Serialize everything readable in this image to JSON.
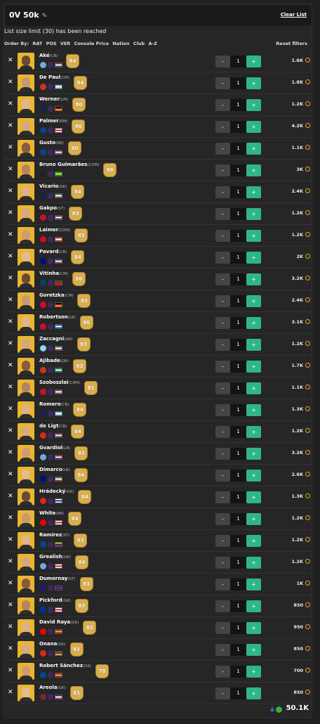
{
  "header": {
    "title": "0V 50k",
    "clear_label": "Clear List"
  },
  "limit_message": "List size limit (30) has been reached",
  "order_by": {
    "label": "Order By:",
    "options": [
      "RAT",
      "POS",
      "VER",
      "Console Price",
      "Nation",
      "Club",
      "A-Z"
    ]
  },
  "reset_label": "Reset filters",
  "players": [
    {
      "name": "Aké",
      "pos": "(CB)",
      "rating": "84",
      "qty": "1",
      "price": "1.6K",
      "club_color": "#6cabdd",
      "flag": [
        "#ae1c28",
        "#ffffff",
        "#21468b"
      ]
    },
    {
      "name": "De Paul",
      "pos": "(CM)",
      "rating": "84",
      "qty": "1",
      "price": "1.8K",
      "club_color": "#cb3524",
      "flag": [
        "#74acdf",
        "#ffffff",
        "#74acdf"
      ]
    },
    {
      "name": "Werner",
      "pos": "(LM)",
      "rating": "80",
      "qty": "1",
      "price": "1.2K",
      "club_color": "#132257",
      "flag": [
        "#000000",
        "#dd0000",
        "#ffce00"
      ]
    },
    {
      "name": "Palmer",
      "pos": "(RM)",
      "rating": "86",
      "qty": "1",
      "price": "4.2K",
      "club_color": "#034694",
      "flag": [
        "#ffffff",
        "#cf142b",
        "#ffffff"
      ]
    },
    {
      "name": "Gusto",
      "pos": "(RB)",
      "rating": "80",
      "qty": "1",
      "price": "1.1K",
      "club_color": "#034694",
      "flag": [
        "#002395",
        "#ffffff",
        "#ed2939"
      ]
    },
    {
      "name": "Bruno Guimarães",
      "pos": "(CDM)",
      "rating": "86",
      "qty": "1",
      "price": "3K",
      "club_color": "#241f20",
      "flag": [
        "#009c3b",
        "#ffdf00",
        "#009c3b"
      ]
    },
    {
      "name": "Vicario",
      "pos": "(GK)",
      "rating": "84",
      "qty": "1",
      "price": "2.4K",
      "club_color": "#132257",
      "flag": [
        "#009246",
        "#ffffff",
        "#ce2b37"
      ]
    },
    {
      "name": "Gakpo",
      "pos": "(ST)",
      "rating": "83",
      "qty": "1",
      "price": "1.2K",
      "club_color": "#c8102e",
      "flag": [
        "#ae1c28",
        "#ffffff",
        "#21468b"
      ]
    },
    {
      "name": "Laimer",
      "pos": "(CDM)",
      "rating": "83",
      "qty": "1",
      "price": "1.2K",
      "club_color": "#dc052d",
      "flag": [
        "#ed2939",
        "#ffffff",
        "#ed2939"
      ]
    },
    {
      "name": "Pavard",
      "pos": "(CB)",
      "rating": "84",
      "qty": "1",
      "price": "2K",
      "club_color": "#010e80",
      "flag": [
        "#002395",
        "#ffffff",
        "#ed2939"
      ]
    },
    {
      "name": "Vitinha",
      "pos": "(CM)",
      "rating": "86",
      "qty": "1",
      "price": "3.2K",
      "club_color": "#004170",
      "flag": [
        "#006600",
        "#ff0000",
        "#ff0000"
      ]
    },
    {
      "name": "Goretzka",
      "pos": "(CM)",
      "rating": "83",
      "qty": "1",
      "price": "2.4K",
      "club_color": "#dc052d",
      "flag": [
        "#000000",
        "#dd0000",
        "#ffce00"
      ]
    },
    {
      "name": "Robertson",
      "pos": "(LB)",
      "rating": "86",
      "qty": "1",
      "price": "3.1K",
      "club_color": "#c8102e",
      "flag": [
        "#005eb8",
        "#ffffff",
        "#005eb8"
      ]
    },
    {
      "name": "Zaccagni",
      "pos": "(LW)",
      "rating": "83",
      "qty": "1",
      "price": "1.2K",
      "club_color": "#87d8f7",
      "flag": [
        "#009246",
        "#ffffff",
        "#ce2b37"
      ]
    },
    {
      "name": "Ajibade",
      "pos": "(LW)",
      "rating": "83",
      "qty": "1",
      "price": "1.7K",
      "club_color": "#cb3524",
      "flag": [
        "#008751",
        "#ffffff",
        "#008751"
      ]
    },
    {
      "name": "Szoboszlai",
      "pos": "(CAM)",
      "rating": "81",
      "qty": "1",
      "price": "1.1K",
      "club_color": "#c8102e",
      "flag": [
        "#ce2939",
        "#ffffff",
        "#477050"
      ]
    },
    {
      "name": "Romero",
      "pos": "(CB)",
      "rating": "84",
      "qty": "1",
      "price": "1.3K",
      "club_color": "#132257",
      "flag": [
        "#74acdf",
        "#ffffff",
        "#74acdf"
      ]
    },
    {
      "name": "de Ligt",
      "pos": "(CB)",
      "rating": "84",
      "qty": "1",
      "price": "1.2K",
      "club_color": "#da291c",
      "flag": [
        "#ae1c28",
        "#ffffff",
        "#21468b"
      ]
    },
    {
      "name": "Gvardiol",
      "pos": "(LB)",
      "rating": "83",
      "qty": "1",
      "price": "3.2K",
      "club_color": "#6cabdd",
      "flag": [
        "#ff0000",
        "#ffffff",
        "#171796"
      ]
    },
    {
      "name": "Dimarco",
      "pos": "(LB)",
      "rating": "84",
      "qty": "1",
      "price": "2.6K",
      "club_color": "#010e80",
      "flag": [
        "#009246",
        "#ffffff",
        "#ce2b37"
      ]
    },
    {
      "name": "Hrádecký",
      "pos": "(GK)",
      "rating": "84",
      "qty": "1",
      "price": "1.3K",
      "club_color": "#e32221",
      "flag": [
        "#ffffff",
        "#003580",
        "#ffffff"
      ]
    },
    {
      "name": "White",
      "pos": "(RB)",
      "rating": "84",
      "qty": "1",
      "price": "1.2K",
      "club_color": "#ef0107",
      "flag": [
        "#ffffff",
        "#cf142b",
        "#ffffff"
      ]
    },
    {
      "name": "Ramírez",
      "pos": "(ST)",
      "rating": "83",
      "qty": "1",
      "price": "1.2K",
      "club_color": "#034694",
      "flag": [
        "#fcd116",
        "#003893",
        "#ce1126"
      ]
    },
    {
      "name": "Grealish",
      "pos": "(LW)",
      "rating": "84",
      "qty": "1",
      "price": "1.2K",
      "club_color": "#6cabdd",
      "flag": [
        "#ffffff",
        "#cf142b",
        "#ffffff"
      ]
    },
    {
      "name": "Dumornay",
      "pos": "(ST)",
      "rating": "83",
      "qty": "1",
      "price": "1K",
      "club_color": "#1a1a7a",
      "flag": [
        "#00209f",
        "#d21034",
        "#00209f"
      ]
    },
    {
      "name": "Pickford",
      "pos": "(GK)",
      "rating": "83",
      "qty": "1",
      "price": "850",
      "club_color": "#003399",
      "flag": [
        "#ffffff",
        "#cf142b",
        "#ffffff"
      ]
    },
    {
      "name": "David Raya",
      "pos": "(GK)",
      "rating": "83",
      "qty": "1",
      "price": "950",
      "club_color": "#ef0107",
      "flag": [
        "#aa151b",
        "#f1bf00",
        "#aa151b"
      ]
    },
    {
      "name": "Onana",
      "pos": "(GK)",
      "rating": "83",
      "qty": "1",
      "price": "850",
      "club_color": "#da291c",
      "flag": [
        "#007a5e",
        "#ce1126",
        "#fcd116"
      ]
    },
    {
      "name": "Robert Sánchez",
      "pos": "(GK)",
      "rating": "78",
      "qty": "1",
      "price": "700",
      "club_color": "#034694",
      "flag": [
        "#aa151b",
        "#f1bf00",
        "#aa151b"
      ]
    },
    {
      "name": "Areola",
      "pos": "(GK)",
      "rating": "81",
      "qty": "1",
      "price": "850",
      "club_color": "#7a263a",
      "flag": [
        "#002395",
        "#ffffff",
        "#ed2939"
      ]
    }
  ],
  "footer": {
    "total": "50.1K"
  },
  "colors": {
    "accent": "#2fb58a",
    "card_gold": "#d9ae4f",
    "coin": "#e0a820",
    "background": "#202020"
  },
  "icons": {
    "edit": "pencil-icon",
    "remove": "close-icon",
    "coin": "coin-icon",
    "platform_ps": "playstation-icon",
    "platform_xbox": "xbox-icon"
  }
}
